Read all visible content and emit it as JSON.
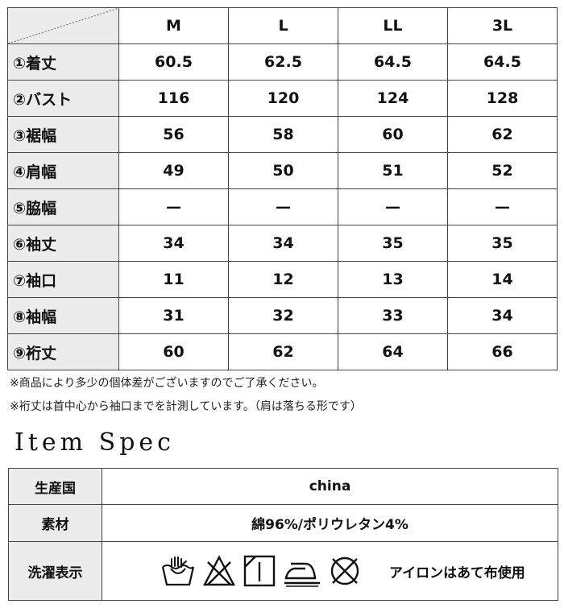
{
  "size_table": {
    "headers": [
      "M",
      "L",
      "LL",
      "3L"
    ],
    "rows": [
      {
        "label": "①着丈",
        "values": [
          "60.5",
          "62.5",
          "64.5",
          "64.5"
        ]
      },
      {
        "label": "②バスト",
        "values": [
          "116",
          "120",
          "124",
          "128"
        ]
      },
      {
        "label": "③裾幅",
        "values": [
          "56",
          "58",
          "60",
          "62"
        ]
      },
      {
        "label": "④肩幅",
        "values": [
          "49",
          "50",
          "51",
          "52"
        ]
      },
      {
        "label": "⑤脇幅",
        "values": [
          "—",
          "—",
          "—",
          "—"
        ]
      },
      {
        "label": "⑥袖丈",
        "values": [
          "34",
          "34",
          "35",
          "35"
        ]
      },
      {
        "label": "⑦袖口",
        "values": [
          "11",
          "12",
          "13",
          "14"
        ]
      },
      {
        "label": "⑧袖幅",
        "values": [
          "31",
          "32",
          "33",
          "34"
        ]
      },
      {
        "label": "⑨裄丈",
        "values": [
          "60",
          "62",
          "64",
          "66"
        ]
      }
    ]
  },
  "notes": [
    "※商品により多少の個体差がございますのでご了承ください。",
    "※裄丈は首中心から袖口までを計測しています。（肩は落ちる形です）"
  ],
  "item_spec": {
    "title": "Item Spec",
    "origin_label": "生産国",
    "origin_value": "china",
    "material_label": "素材",
    "material_value": "綿96%/ポリウレタン4%",
    "care_label": "洗濯表示",
    "care_text": "アイロンはあて布使用",
    "care_icons": [
      "hand-wash-icon",
      "no-bleach-icon",
      "line-dry-shade-icon",
      "iron-cloth-icon",
      "no-dry-clean-icon"
    ]
  }
}
